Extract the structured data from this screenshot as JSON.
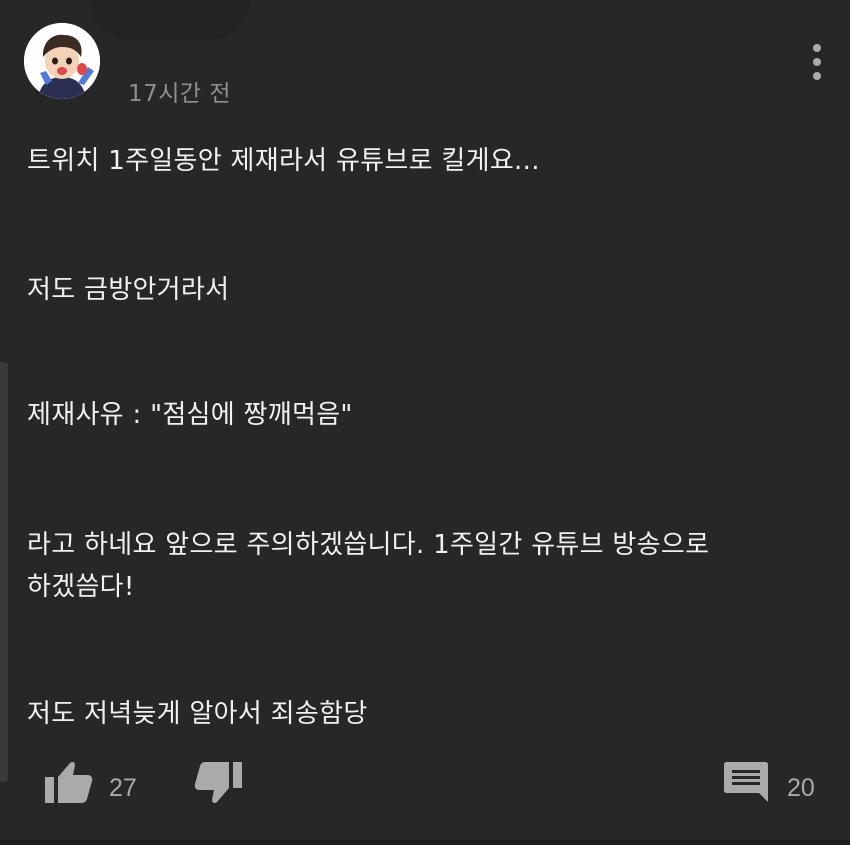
{
  "comment": {
    "timestamp": "17시간 전",
    "lines": [
      "트위치 1주일동안 제재라서 유튜브로 킬게요...",
      "저도 금방안거라서",
      "제재사유 : \"점심에 짱깨먹음\"",
      "라고 하네요 앞으로 주의하겠씁니다. 1주일간 유튜브 방송으로",
      "하겠씀다!",
      "저도 저녁늦게 알아서 죄송함당"
    ]
  },
  "actions": {
    "like_count": "27",
    "reply_count": "20"
  },
  "icons": {
    "avatar": "avatar-icon",
    "more": "more-vert-icon",
    "like": "thumb-up-icon",
    "dislike": "thumb-down-icon",
    "reply": "comment-icon"
  },
  "colors": {
    "background": "#272727",
    "text": "#f1f1f1",
    "secondary_text": "#8f8f8f",
    "icon": "#aaaaaa"
  }
}
